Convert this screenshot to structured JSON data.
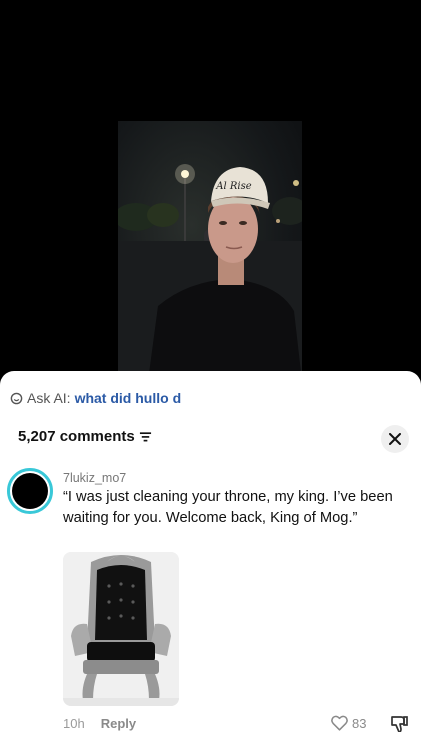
{
  "video": {
    "cap_text": "Al Rise"
  },
  "ask_ai": {
    "label": "Ask AI:",
    "query": "what did hullo d",
    "icon": "ai-search-icon"
  },
  "comments": {
    "count_label": "5,207 comments",
    "sort_icon": "sort-lines-icon",
    "close_icon": "close-icon"
  },
  "comment": {
    "username": "7lukiz_mo7",
    "text": "“I was just cleaning your throne, my king. I’ve been waiting for you. Welcome back, King of Mog.”",
    "image": "throne-image",
    "time": "10h",
    "reply_label": "Reply",
    "likes": "83",
    "avatar_ring_color": "#39c8d8"
  }
}
